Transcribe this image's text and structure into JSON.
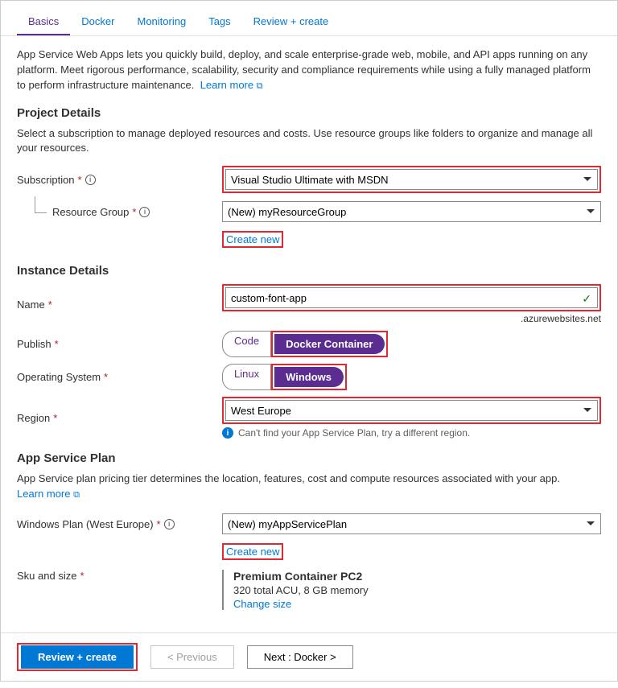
{
  "tabs": {
    "basics": "Basics",
    "docker": "Docker",
    "monitoring": "Monitoring",
    "tags": "Tags",
    "review": "Review + create"
  },
  "intro": {
    "text": "App Service Web Apps lets you quickly build, deploy, and scale enterprise-grade web, mobile, and API apps running on any platform. Meet rigorous performance, scalability, security and compliance requirements while using a fully managed platform to perform infrastructure maintenance.",
    "learn_more": "Learn more"
  },
  "project": {
    "heading": "Project Details",
    "desc": "Select a subscription to manage deployed resources and costs. Use resource groups like folders to organize and manage all your resources.",
    "subscription_label": "Subscription",
    "subscription_value": "Visual Studio Ultimate with MSDN",
    "rg_label": "Resource Group",
    "rg_value": "(New) myResourceGroup",
    "create_new": "Create new"
  },
  "instance": {
    "heading": "Instance Details",
    "name_label": "Name",
    "name_value": "custom-font-app",
    "suffix": ".azurewebsites.net",
    "publish_label": "Publish",
    "publish_code": "Code",
    "publish_docker": "Docker Container",
    "os_label": "Operating System",
    "os_linux": "Linux",
    "os_windows": "Windows",
    "region_label": "Region",
    "region_value": "West Europe",
    "region_info": "Can't find your App Service Plan, try a different region."
  },
  "plan": {
    "heading": "App Service Plan",
    "desc": "App Service plan pricing tier determines the location, features, cost and compute resources associated with your app.",
    "learn_more": "Learn more",
    "win_plan_label": "Windows Plan (West Europe)",
    "win_plan_value": "(New) myAppServicePlan",
    "create_new": "Create new",
    "sku_label": "Sku and size",
    "sku_title": "Premium Container PC2",
    "sku_detail": "320 total ACU, 8 GB memory",
    "change_size": "Change size"
  },
  "footer": {
    "review": "Review + create",
    "prev": "< Previous",
    "next": "Next : Docker >"
  }
}
